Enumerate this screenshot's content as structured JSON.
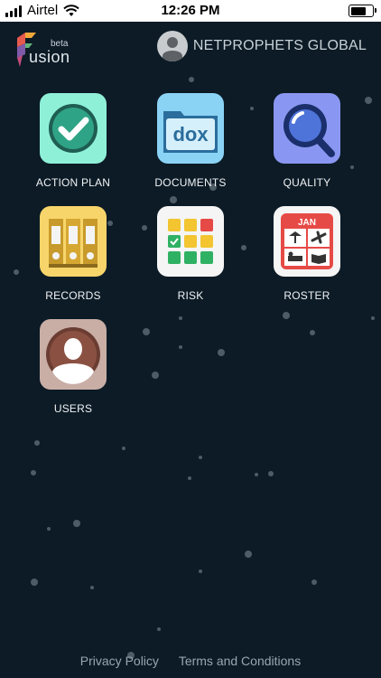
{
  "status_bar": {
    "carrier": "Airtel",
    "time": "12:26 PM"
  },
  "header": {
    "logo_beta": "beta",
    "logo_wordmark": "usion",
    "account_name": "NETPROPHETS GLOBAL"
  },
  "apps": [
    {
      "label": "ACTION PLAN",
      "icon": "check-icon",
      "color": "#8ff0d8"
    },
    {
      "label": "DOCUMENTS",
      "icon": "folder-dox-icon",
      "color": "#8bd3f5",
      "text": "dox"
    },
    {
      "label": "QUALITY",
      "icon": "magnifier-icon",
      "color": "#8a97f2"
    },
    {
      "label": "RECORDS",
      "icon": "binders-icon",
      "color": "#f7d56a"
    },
    {
      "label": "RISK",
      "icon": "risk-grid-icon",
      "color": "#f5f5f5"
    },
    {
      "label": "ROSTER",
      "icon": "calendar-icon",
      "color": "#f5f5f5",
      "month": "JAN"
    },
    {
      "label": "USERS",
      "icon": "user-silhouette-icon",
      "color": "#c9aea6"
    }
  ],
  "footer": {
    "privacy": "Privacy Policy",
    "terms": "Terms and Conditions"
  },
  "colors": {
    "background": "#0c1b26"
  }
}
